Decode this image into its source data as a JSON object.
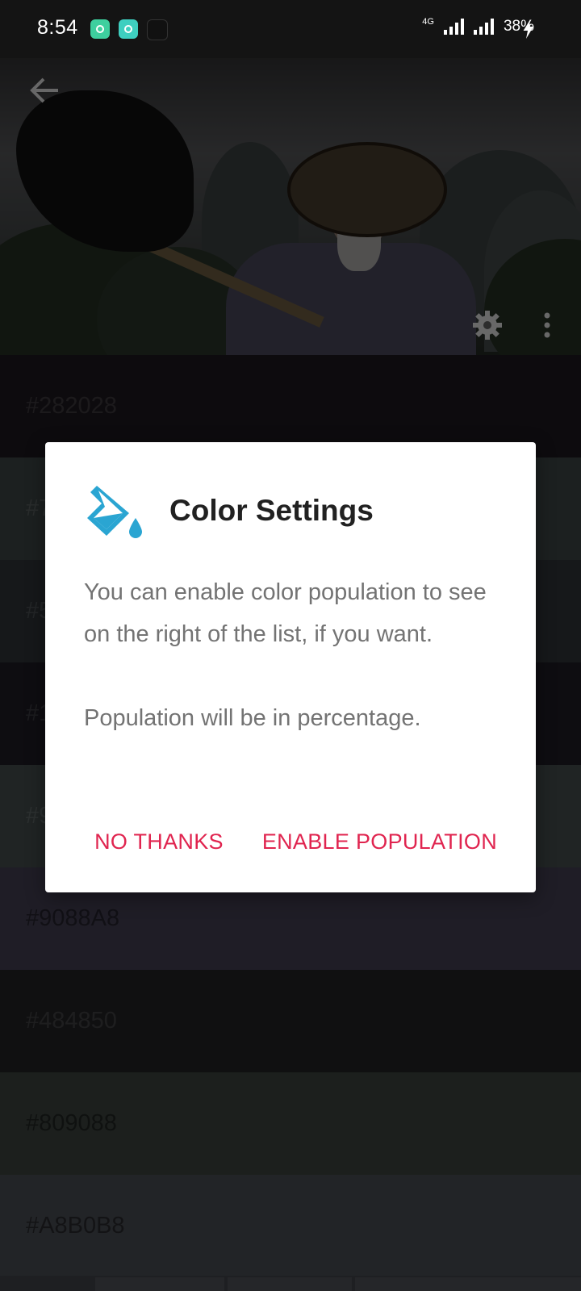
{
  "status_bar": {
    "time": "8:54",
    "network": "4G",
    "battery": "38%"
  },
  "header": {
    "icons": [
      "back-arrow-icon",
      "gear-icon",
      "more-vert-icon"
    ]
  },
  "swatches": [
    {
      "hex": "#282028",
      "color": "#1b171c"
    },
    {
      "hex": "#7",
      "color": "#394040"
    },
    {
      "hex": "#5",
      "color": "#2c3134"
    },
    {
      "hex": "#1",
      "color": "#1c1b22"
    },
    {
      "hex": "#9",
      "color": "#414949"
    },
    {
      "hex": "#9088A8",
      "color": "#3f3b4d"
    },
    {
      "hex": "#484850",
      "color": "#202023"
    },
    {
      "hex": "#809088",
      "color": "#383f3b"
    },
    {
      "hex": "#A8B0B8",
      "color": "#45484e"
    }
  ],
  "dialog": {
    "icon": "paint-bucket-icon",
    "title": "Color Settings",
    "body_1": "You can enable color population to see on the right of the list, if you want.",
    "body_2": "Population will be in percentage.",
    "negative_label": "No Thanks",
    "positive_label": "Enable Population",
    "accent_color": "#e0244f",
    "icon_color": "#2aa5d2"
  }
}
